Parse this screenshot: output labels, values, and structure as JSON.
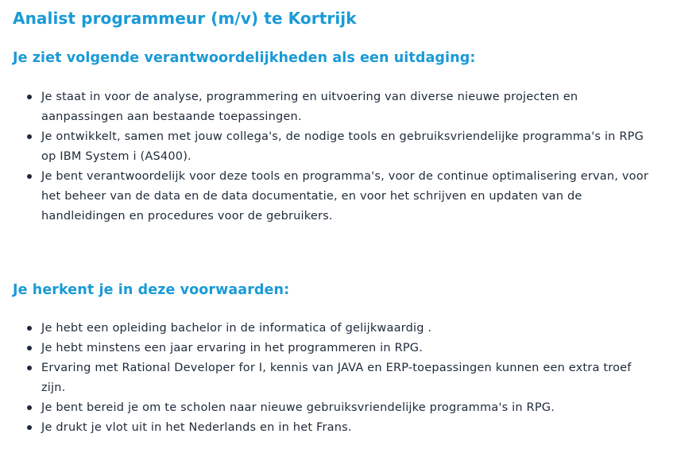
{
  "title": "Analist programmeur (m/v) te Kortrijk",
  "sections": [
    {
      "heading": "Je ziet volgende verantwoordelijkheden als een uitdaging:",
      "items": [
        "Je staat in voor de analyse, programmering en uitvoering van diverse nieuwe projecten en aanpassingen aan bestaande toepassingen.",
        "Je ontwikkelt, samen met jouw collega's, de nodige tools en gebruiksvriendelijke programma's in RPG op IBM System i (AS400).",
        "Je bent verantwoordelijk voor deze tools en programma's, voor de continue optimalisering ervan, voor het beheer van de data en de data documentatie, en voor het schrijven en updaten van de handleidingen en procedures voor de gebruikers."
      ]
    },
    {
      "heading": "Je herkent je in deze voorwaarden:",
      "items": [
        "Je hebt een opleiding bachelor in de informatica of gelijkwaardig .",
        "Je hebt minstens een jaar ervaring in het programmeren in RPG.",
        "Ervaring met Rational Developer for I, kennis van JAVA en ERP-toepassingen kunnen een extra troef zijn.",
        "Je bent bereid je om te scholen naar nieuwe gebruiksvriendelijke programma's in RPG.",
        "Je drukt je vlot uit in het Nederlands en in het Frans."
      ]
    }
  ]
}
